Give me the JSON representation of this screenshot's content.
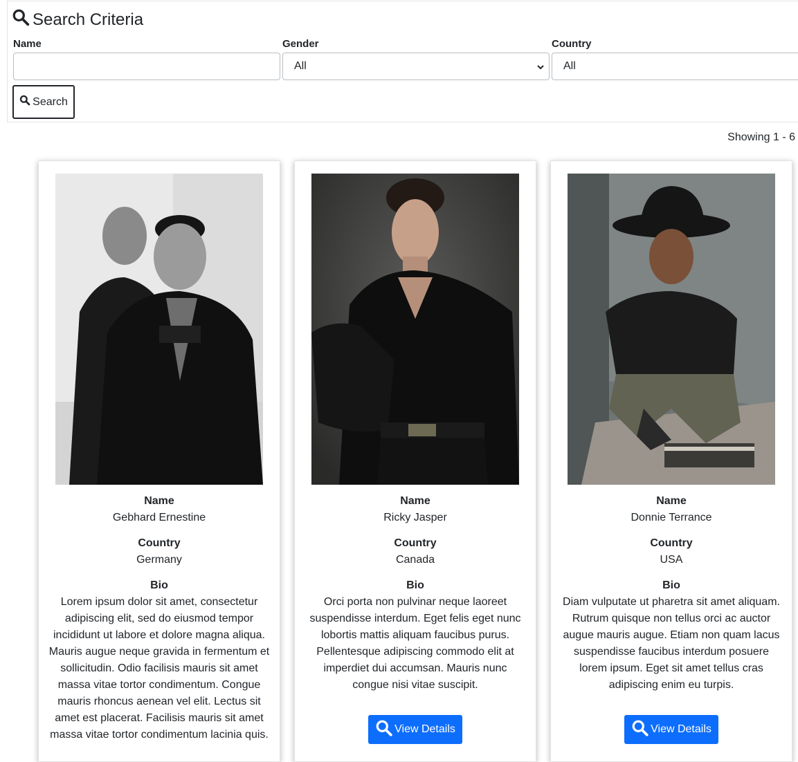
{
  "search": {
    "title": "Search Criteria",
    "name_label": "Name",
    "name_value": "",
    "gender_label": "Gender",
    "gender_value": "All",
    "country_label": "Country",
    "country_value": "All",
    "button_label": "Search"
  },
  "results": {
    "showing": "Showing 1 - 6"
  },
  "labels": {
    "name": "Name",
    "country": "Country",
    "bio": "Bio",
    "view_details": "View Details"
  },
  "cards": [
    {
      "name": "Gebhard Ernestine",
      "country": "Germany",
      "bio": "Lorem ipsum dolor sit amet, consectetur adipiscing elit, sed do eiusmod tempor incididunt ut labore et dolore magna aliqua. Mauris augue neque gravida in fermentum et sollicitudin. Odio facilisis mauris sit amet massa vitae tortor condimentum. Congue mauris rhoncus aenean vel elit. Lectus sit amet est placerat. Facilisis mauris sit amet massa vitae tortor condimentum lacinia quis."
    },
    {
      "name": "Ricky Jasper",
      "country": "Canada",
      "bio": "Orci porta non pulvinar neque laoreet suspendisse interdum. Eget felis eget nunc lobortis mattis aliquam faucibus purus. Pellentesque adipiscing commodo elit at imperdiet dui accumsan. Mauris nunc congue nisi vitae suscipit."
    },
    {
      "name": "Donnie Terrance",
      "country": "USA",
      "bio": "Diam vulputate ut pharetra sit amet aliquam. Rutrum quisque non tellus orci ac auctor augue mauris augue. Etiam non quam lacus suspendisse faucibus interdum posuere lorem ipsum. Eget sit amet tellus cras adipiscing enim eu turpis."
    }
  ],
  "colors": {
    "primary_button": "#0d6efd",
    "text": "#212529",
    "border": "#dee2e6"
  }
}
